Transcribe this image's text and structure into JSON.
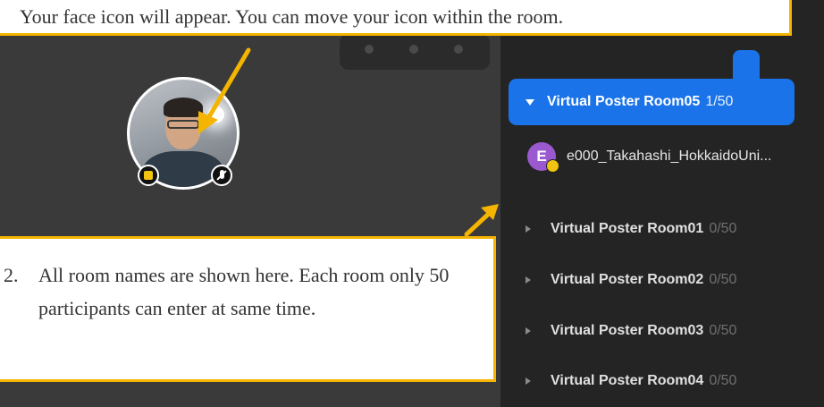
{
  "callouts": {
    "top_text": "Your face icon will appear. You can move your icon within the room.",
    "bottom_number": "2.",
    "bottom_text": "All room names are shown here. Each room only 50 participants can enter at same time."
  },
  "sidebar": {
    "active_room": {
      "name": "Virtual Poster Room05",
      "count": "1/50"
    },
    "member": {
      "initial": "E",
      "name": "e000_Takahashi_HokkaidoUni..."
    },
    "rooms": [
      {
        "name": "Virtual Poster Room01",
        "count": "0/50"
      },
      {
        "name": "Virtual Poster Room02",
        "count": "0/50"
      },
      {
        "name": "Virtual Poster Room03",
        "count": "0/50"
      },
      {
        "name": "Virtual Poster Room04",
        "count": "0/50"
      }
    ]
  },
  "colors": {
    "accent": "#1a73e8",
    "callout_border": "#f4b400",
    "avatar": "#9b59d0",
    "host_badge": "#f1c40f"
  },
  "icons": {
    "host": "host-badge-icon",
    "mic": "mic-off-icon",
    "expand": "chevron-down-icon",
    "collapse": "chevron-right-icon"
  }
}
